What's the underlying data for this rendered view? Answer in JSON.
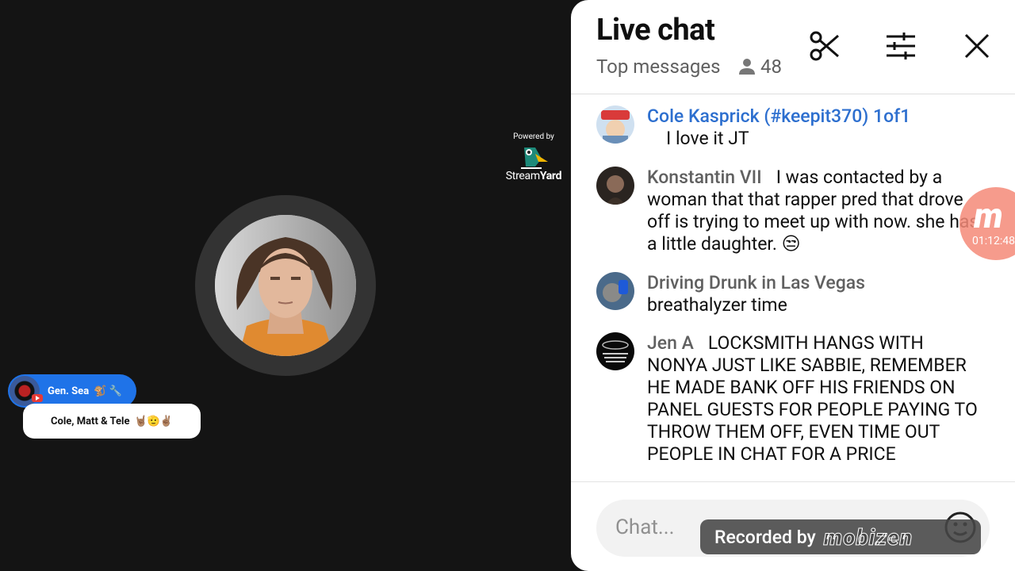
{
  "video": {
    "powered_by": "Powered by",
    "brand_left": "Stream",
    "brand_right": "Yard",
    "guest_tag_name": "Gen. Sea",
    "guest_tag_emojis": "🐒 🔧",
    "show_label": "Cole, Matt & Tele",
    "show_label_emojis": "🤘🏽🫡✌🏽"
  },
  "header": {
    "title": "Live chat",
    "filter": "Top messages",
    "viewer_count": "48"
  },
  "messages": [
    {
      "author": "Cole Kasprick (#keepit370) 1of1",
      "author_type": "moderator",
      "text": "I love it JT"
    },
    {
      "author": "Konstantin VII",
      "author_type": "normal",
      "text": "I was contacted by a woman that that rapper pred that drove off is trying to meet up with now. she has a little daughter. 😒"
    },
    {
      "author": "Driving Drunk in Las Vegas",
      "author_type": "normal",
      "text": "breathalyzer time"
    },
    {
      "author": "Jen A",
      "author_type": "normal",
      "text": "LOCKSMITH HANGS WITH NONYA JUST LIKE SABBIE, REMEMBER HE MADE BANK OFF HIS FRIENDS ON PANEL GUESTS FOR PEOPLE PAYING TO THROW THEM OFF, EVEN TIME OUT PEOPLE IN CHAT FOR A PRICE"
    }
  ],
  "input": {
    "placeholder": "Chat..."
  },
  "overlay": {
    "mobizen_letter": "m",
    "timer": "01:12:48",
    "recorded_by": "Recorded by",
    "recorder_brand": "mobizen"
  },
  "colors": {
    "accent_moderator": "#2d6fcf",
    "tag_blue": "#1f73e8"
  }
}
